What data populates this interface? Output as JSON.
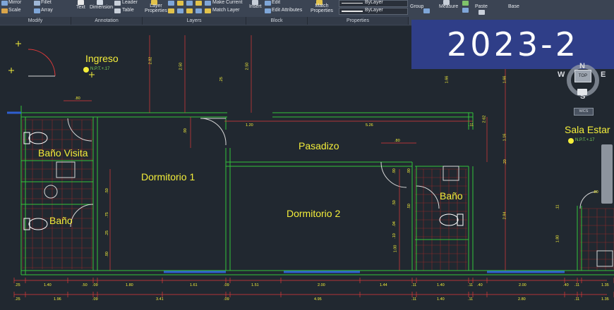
{
  "ribbon": {
    "modify": {
      "mirror": "Mirror",
      "fillet": "Fillet",
      "scale": "Scale",
      "array": "Array",
      "title": "Modify"
    },
    "annotation": {
      "text": "Text",
      "dimension": "Dimension",
      "leader": "Leader",
      "table": "Table",
      "title": "Annotation"
    },
    "layers": {
      "layer_properties": "Layer\nProperties",
      "make_current": "Make Current",
      "match_layer": "Match Layer",
      "title": "Layers"
    },
    "block": {
      "insert": "Insert",
      "edit": "Edit",
      "edit_attributes": "Edit Attributes",
      "title": "Block"
    },
    "properties": {
      "match_properties": "Match\nProperties",
      "linetype": "ByLayer",
      "lineweight": "ByLayer",
      "title": "Properties"
    },
    "groups": {
      "group": "Group"
    },
    "utilities": {
      "measure": "Measure"
    },
    "clipboard": {
      "paste": "Paste"
    },
    "view": {
      "base": "Base"
    }
  },
  "overlay": {
    "text": "2023-2",
    "color": "#2f3e88"
  },
  "navigation": {
    "compass": {
      "north": "N",
      "south": "S",
      "east": "E",
      "west": "W",
      "top": "TOP"
    },
    "wcs": "WCS"
  },
  "rooms": {
    "ingreso": "Ingreso",
    "bano_visita": "Baño Visita",
    "dormitorio1": "Dormitorio 1",
    "pasadizo": "Pasadizo",
    "dormitorio2": "Dormitorio 2",
    "bano1": "Baño",
    "bano2": "Baño",
    "sala_estar": "Sala Estar"
  },
  "levels": {
    "ingreso": "N.P.T.+.17",
    "sala": "N.P.T.+.17"
  },
  "dimensions": {
    "row1": [
      ".25",
      "1.40",
      ".50",
      ".09",
      "1.80",
      "1.61",
      ".09",
      "1.51",
      "2.00",
      "1.44",
      ".11",
      "1.40",
      ".11",
      ".40",
      "2.00",
      ".40",
      ".11",
      "1.35"
    ],
    "row2": [
      ".25",
      "1.96",
      ".09",
      "3.41",
      ".09",
      "4.95",
      ".11",
      "1.40",
      ".11",
      "2.80",
      ".11",
      "1.35"
    ],
    "vertical": [
      "2.82",
      "2.50",
      "2.50",
      ".25",
      ".90",
      ".50",
      ".75",
      ".25",
      ".90",
      ".90",
      ".50",
      "1.00",
      ".04",
      ".10",
      ".90",
      ".50",
      "1.66",
      "1.66",
      "2.62",
      "1.16",
      "1.16",
      ".20",
      "2.84",
      "2.84",
      ".11",
      "1.80"
    ],
    "horizontal": [
      ".80",
      "1.20",
      "5.26",
      ".11",
      ".80",
      ".80",
      ".80"
    ]
  },
  "colors": {
    "background": "#212830",
    "wall": "#33c43a",
    "dimension": "#e23a3a",
    "text": "#f4ee3a",
    "ribbon": "#3b4453"
  }
}
